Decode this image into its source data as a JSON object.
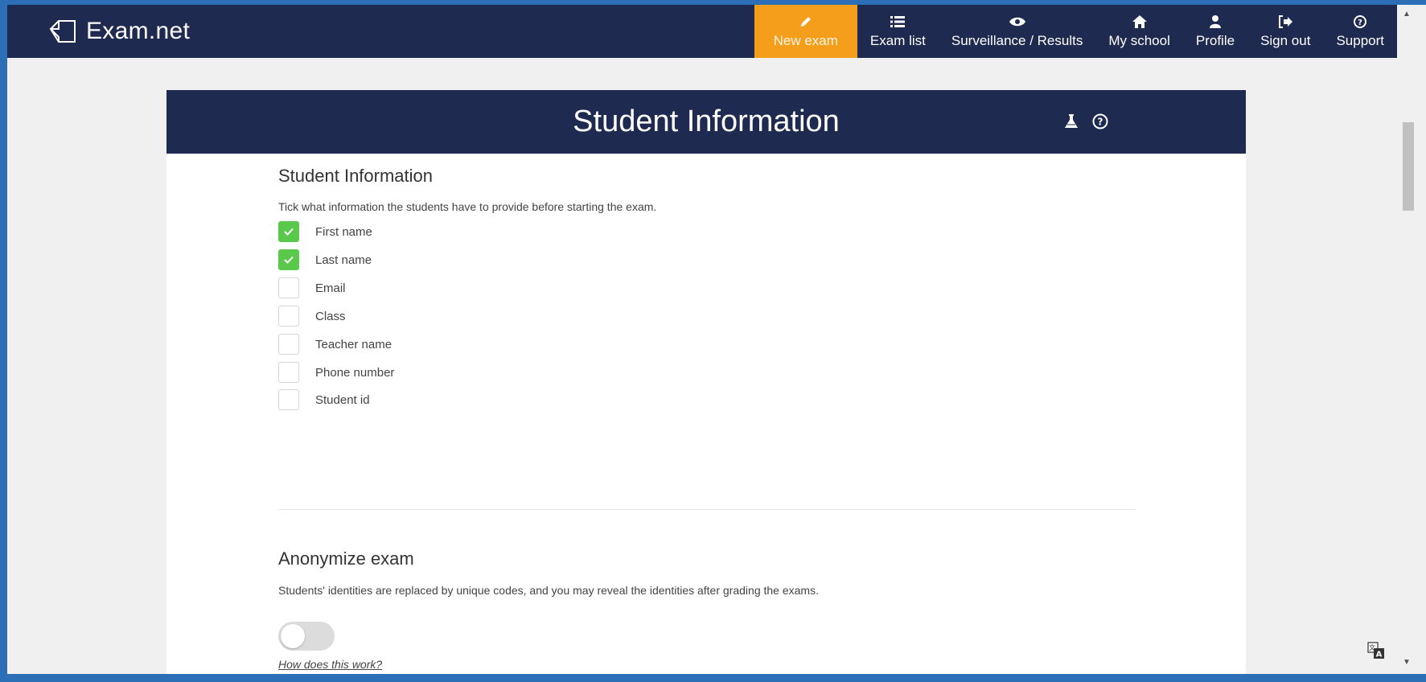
{
  "app": {
    "logo_text": "Exam.net"
  },
  "nav": [
    {
      "label": "New exam",
      "icon": "pencil-icon",
      "active": true
    },
    {
      "label": "Exam list",
      "icon": "list-icon"
    },
    {
      "label": "Surveillance / Results",
      "icon": "eye-icon"
    },
    {
      "label": "My school",
      "icon": "home-icon"
    },
    {
      "label": "Profile",
      "icon": "user-icon"
    },
    {
      "label": "Sign out",
      "icon": "sign-out-icon"
    },
    {
      "label": "Support",
      "icon": "question-circle-icon"
    }
  ],
  "card": {
    "title": "Student Information",
    "header_icons": [
      "flask-icon",
      "question-circle-icon"
    ]
  },
  "student_info": {
    "title": "Student Information",
    "description": "Tick what information the students have to provide before starting the exam.",
    "fields": [
      {
        "label": "First name",
        "checked": true
      },
      {
        "label": "Last name",
        "checked": true
      },
      {
        "label": "Email",
        "checked": false
      },
      {
        "label": "Class",
        "checked": false
      },
      {
        "label": "Teacher name",
        "checked": false
      },
      {
        "label": "Phone number",
        "checked": false
      },
      {
        "label": "Student id",
        "checked": false
      }
    ]
  },
  "anonymize": {
    "title": "Anonymize exam",
    "description": "Students' identities are replaced by unique codes, and you may reveal the identities after grading the exams.",
    "enabled": false,
    "help_link": "How does this work?"
  },
  "colors": {
    "navy": "#1e2a4f",
    "accent_orange": "#f59e1c",
    "check_green": "#5ac94b"
  }
}
